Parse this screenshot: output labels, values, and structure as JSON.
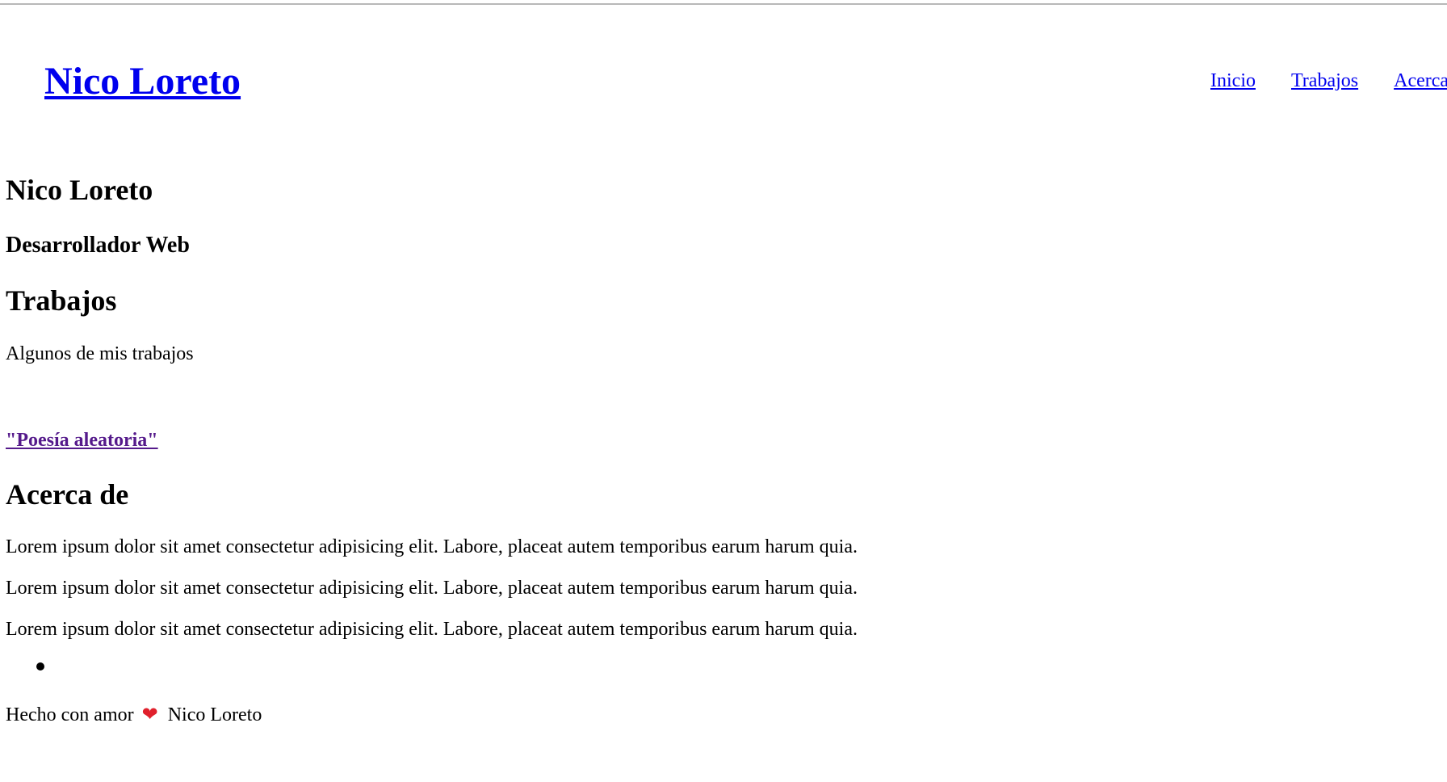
{
  "header": {
    "logo": "Nico Loreto",
    "nav": {
      "inicio": "Inicio",
      "trabajos": "Trabajos",
      "acerca": "Acerca de"
    }
  },
  "hero": {
    "title": "Nico Loreto",
    "subtitle": "Desarrollador Web"
  },
  "works": {
    "title": "Trabajos",
    "description": "Algunos de mis trabajos",
    "items": [
      {
        "label": "\"Poesía aleatoria\""
      }
    ]
  },
  "about": {
    "title": "Acerca de",
    "paragraphs": [
      "Lorem ipsum dolor sit amet consectetur adipisicing elit. Labore, placeat autem temporibus earum harum quia.",
      "Lorem ipsum dolor sit amet consectetur adipisicing elit. Labore, placeat autem temporibus earum harum quia.",
      "Lorem ipsum dolor sit amet consectetur adipisicing elit. Labore, placeat autem temporibus earum harum quia."
    ]
  },
  "footer": {
    "prefix": "Hecho con amor",
    "heart_icon": "heart-icon",
    "heart_glyph": "❤",
    "heart_color": "#e0202c",
    "author": "Nico Loreto"
  },
  "colors": {
    "link": "#0000ee",
    "visited_link": "#551a8b",
    "text": "#000000",
    "background": "#ffffff"
  }
}
